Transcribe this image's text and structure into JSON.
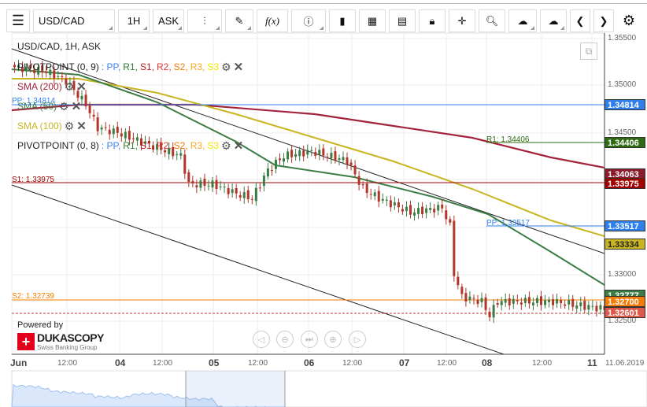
{
  "toolbar": {
    "instrument": "USD/CAD",
    "period": "1H",
    "side": "ASK",
    "fx_label": "f(x)"
  },
  "chart": {
    "title": "USD/CAD, 1H, ASK",
    "legends": [
      {
        "name": "PIVOTPOINT (0, 9)",
        "parts": [
          ": PP,",
          "R1,",
          "S1,",
          "R2,",
          "S2,",
          "R3,",
          "S3"
        ]
      },
      {
        "name": "SMA (200)"
      },
      {
        "name": "SMA (50)"
      },
      {
        "name": "SMA (100)"
      },
      {
        "name": "PIVOTPOINT (0, 8)",
        "parts": [
          ": PP,",
          "R1,",
          "S1,",
          "R2,",
          "S2,",
          "R3,",
          "S3"
        ]
      }
    ],
    "part_colors": [
      "#3b82f6",
      "#2e7d32",
      "#b71c1c",
      "#e53935",
      "#f57c00",
      "#f9a825",
      "#f5e400"
    ],
    "price_axis": [
      "1.35500",
      "1.35000",
      "1.34500",
      "1.33000",
      "1.32500"
    ],
    "price_boxes": [
      {
        "v": "1.34814",
        "color": "#2f80ed"
      },
      {
        "v": "1.34406",
        "color": "#2e6b12"
      },
      {
        "v": "1.34063",
        "color": "#8b1a2b"
      },
      {
        "v": "1.33975",
        "color": "#a30000"
      },
      {
        "v": "1.33517",
        "color": "#2f80ed"
      },
      {
        "v": "1.33334",
        "color": "#c9b520"
      },
      {
        "v": "1.32777",
        "color": "#3b7d45"
      },
      {
        "v": "1.32700",
        "color": "#f57c00"
      },
      {
        "v": "1.32601",
        "color": "#dd5a4a"
      }
    ],
    "level_labels": {
      "r1": "R1: 1.34406",
      "pp": "PP: 1.33517",
      "s1": "S1: 1.33975",
      "s2": "S2: 1.32739",
      "pp_old": "PP: 1.34814"
    },
    "time_axis": {
      "days": [
        "Jun",
        "04",
        "05",
        "06",
        "07",
        "08",
        "11"
      ],
      "noon": "12:00",
      "date": "11.06.2019"
    },
    "price_path": [
      [
        0,
        1.352
      ],
      [
        9,
        1.3515
      ],
      [
        14,
        1.3505
      ],
      [
        19,
        1.348
      ],
      [
        22,
        1.3455
      ],
      [
        27,
        1.345
      ],
      [
        33,
        1.344
      ],
      [
        43,
        1.3425
      ],
      [
        45,
        1.3395
      ],
      [
        51,
        1.3395
      ],
      [
        57,
        1.3385
      ],
      [
        61,
        1.338
      ],
      [
        65,
        1.341
      ],
      [
        69,
        1.3425
      ],
      [
        76,
        1.343
      ],
      [
        85,
        1.342
      ],
      [
        89,
        1.339
      ],
      [
        93,
        1.338
      ],
      [
        101,
        1.3365
      ],
      [
        109,
        1.337
      ],
      [
        111,
        1.335
      ],
      [
        112,
        1.33
      ],
      [
        114,
        1.3275
      ],
      [
        119,
        1.327
      ],
      [
        121,
        1.3255
      ],
      [
        123,
        1.327
      ],
      [
        137,
        1.327
      ],
      [
        150,
        1.3262
      ]
    ]
  },
  "branding": {
    "powered": "Powered by",
    "brand": "DUKASCOPY",
    "sub": "Swiss Banking Group"
  }
}
